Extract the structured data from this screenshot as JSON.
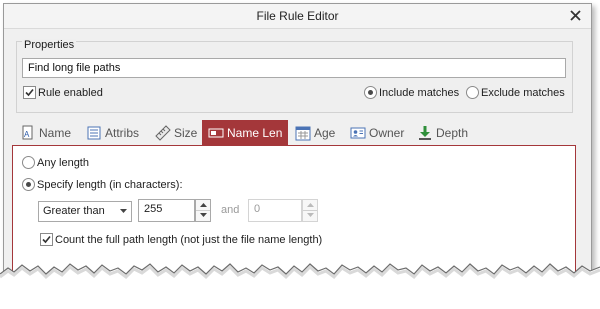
{
  "window": {
    "title": "File Rule Editor"
  },
  "properties": {
    "group_label": "Properties",
    "name_value": "Find long file paths",
    "rule_enabled_label": "Rule enabled",
    "rule_enabled": true,
    "include_label": "Include matches",
    "exclude_label": "Exclude matches",
    "match_mode": "include"
  },
  "tabs": [
    {
      "label": "Name",
      "icon": "name-icon",
      "active": false
    },
    {
      "label": "Attribs",
      "icon": "attribs-icon",
      "active": false
    },
    {
      "label": "Size",
      "icon": "ruler-icon",
      "active": false
    },
    {
      "label": "Name Len",
      "icon": "name-length-icon",
      "active": true
    },
    {
      "label": "Age",
      "icon": "calendar-icon",
      "active": false
    },
    {
      "label": "Owner",
      "icon": "owner-card-icon",
      "active": false
    },
    {
      "label": "Depth",
      "icon": "depth-arrow-icon",
      "active": false
    }
  ],
  "name_len": {
    "any_length_label": "Any length",
    "specify_length_label": "Specify length (in characters):",
    "selected_option": "specify",
    "comparison": "Greater than",
    "value1": "255",
    "and_label": "and",
    "value2": "0",
    "full_path_label": "Count the full path length (not just the file name length)",
    "full_path_checked": true
  },
  "colors": {
    "accent": "#a4373a",
    "window_bg": "#f0f0f0",
    "panel_bg": "#ffffff"
  }
}
